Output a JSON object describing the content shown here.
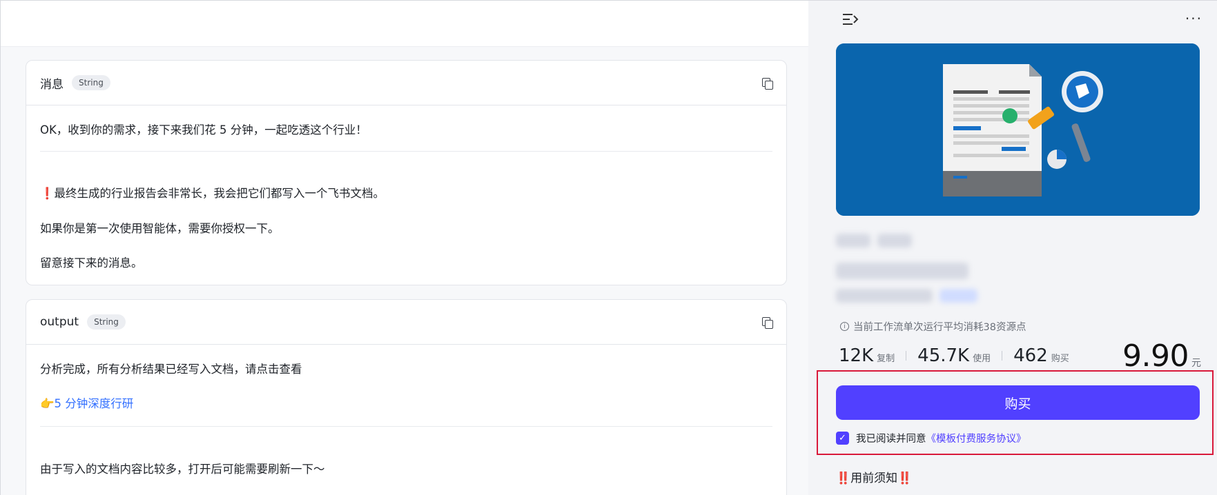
{
  "card1": {
    "title": "消息",
    "tag": "String",
    "line1": "OK，收到你的需求，接下来我们花 5 分钟，一起吃透这个行业！",
    "line2_mark": "❗",
    "line2": "最终生成的行业报告会非常长，我会把它们都写入一个飞书文档。",
    "line3": "如果你是第一次使用智能体，需要你授权一下。",
    "line4": "留意接下来的消息。"
  },
  "card2": {
    "title": "output",
    "tag": "String",
    "line1": "分析完成，所有分析结果已经写入文档，请点击查看",
    "link_icon": "👉",
    "link_text": "5 分钟深度行研",
    "line3": "由于写入的文档内容比较多，打开后可能需要刷新一下～"
  },
  "right": {
    "more": "···",
    "info": "当前工作流单次运行平均消耗38资源点",
    "info_icon": "i",
    "stats": [
      {
        "value": "12K",
        "label": "复制"
      },
      {
        "value": "45.7K",
        "label": "使用"
      },
      {
        "value": "462",
        "label": "购买"
      }
    ],
    "price": "9.90",
    "price_unit": "元",
    "buy_label": "购买",
    "checkbox_mark": "✓",
    "agree_text": "我已阅读并同意",
    "agree_link": "《模板付费服务协议》",
    "notice_mark": "‼️",
    "notice_text": "用前须知"
  },
  "colors": {
    "accent": "#5140ff",
    "link": "#3370ff",
    "cover_bg": "#0a65ad",
    "highlight_border": "#d9193a"
  },
  "icons": [
    "copy-icon",
    "menu-collapse-icon",
    "more-icon",
    "info-icon",
    "checkbox-checked-icon"
  ]
}
